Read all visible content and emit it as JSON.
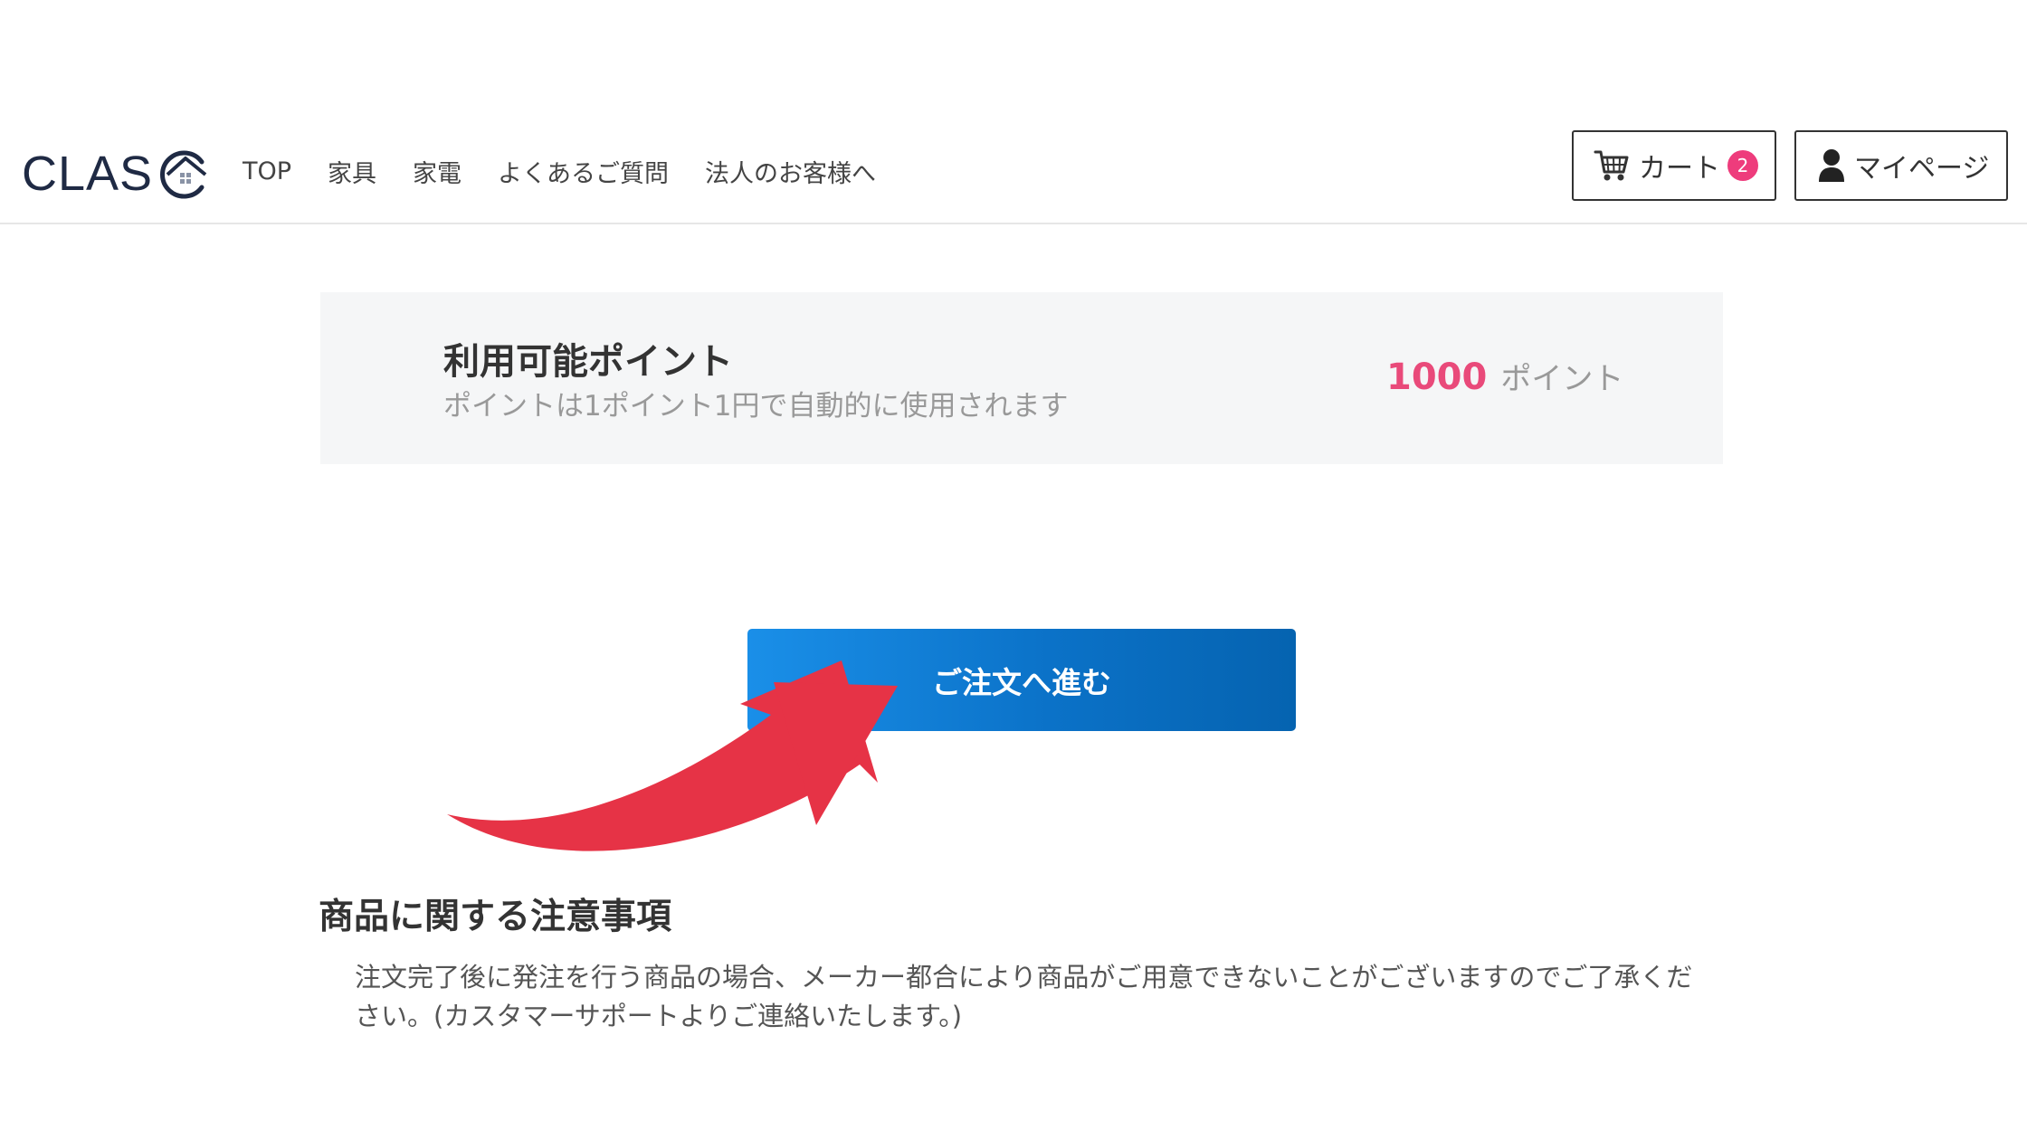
{
  "header": {
    "logo": {
      "text": "CLAS",
      "mark_icon": "house-c-icon"
    },
    "nav": [
      {
        "label": "TOP"
      },
      {
        "label": "家具"
      },
      {
        "label": "家電"
      },
      {
        "label": "よくあるご質問"
      },
      {
        "label": "法人のお客様へ"
      }
    ],
    "cart": {
      "icon": "cart-icon",
      "label": "カート",
      "count": "2"
    },
    "mypage": {
      "icon": "user-icon",
      "label": "マイページ"
    }
  },
  "points": {
    "title": "利用可能ポイント",
    "subtitle": "ポイントは1ポイント1円で自動的に使用されます",
    "value": "1000",
    "unit": "ポイント"
  },
  "order_button": {
    "label": "ご注文へ進む"
  },
  "annotation": {
    "icon": "curved-arrow-icon",
    "color": "#e63346"
  },
  "notes": {
    "title": "商品に関する注意事項",
    "body": "注文完了後に発注を行う商品の場合、メーカー都合により商品がご用意できないことがございますのでご了承ください。(カスタマーサポートよりご連絡いたします。)"
  },
  "colors": {
    "accent_blue": "#0b72c8",
    "points_pink": "#e94a7a",
    "badge_pink": "#ee3c7c"
  }
}
